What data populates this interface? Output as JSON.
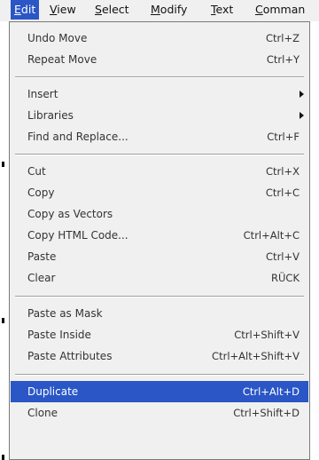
{
  "menubar": {
    "items": [
      {
        "label": "Edit",
        "u": "E",
        "rest": "dit"
      },
      {
        "label": "View",
        "u": "V",
        "rest": "iew"
      },
      {
        "label": "Select",
        "u": "S",
        "rest": "elect"
      },
      {
        "label": "Modify",
        "u": "M",
        "rest": "odify"
      },
      {
        "label": "Text",
        "u": "T",
        "rest": "ext"
      },
      {
        "label": "Comman",
        "u": "C",
        "rest": "omman"
      }
    ]
  },
  "dropdown": {
    "items": [
      {
        "label": "Undo Move",
        "shortcut": "Ctrl+Z"
      },
      {
        "label": "Repeat Move",
        "shortcut": "Ctrl+Y"
      },
      {
        "label": "Insert",
        "shortcut": ""
      },
      {
        "label": "Libraries",
        "shortcut": ""
      },
      {
        "label": "Find and Replace...",
        "shortcut": "Ctrl+F"
      },
      {
        "label": "Cut",
        "shortcut": "Ctrl+X"
      },
      {
        "label": "Copy",
        "shortcut": "Ctrl+C"
      },
      {
        "label": "Copy as Vectors",
        "shortcut": ""
      },
      {
        "label": "Copy HTML Code...",
        "shortcut": "Ctrl+Alt+C"
      },
      {
        "label": "Paste",
        "shortcut": "Ctrl+V"
      },
      {
        "label": "Clear",
        "shortcut": "RÜCK"
      },
      {
        "label": "Paste as Mask",
        "shortcut": ""
      },
      {
        "label": "Paste Inside",
        "shortcut": "Ctrl+Shift+V"
      },
      {
        "label": "Paste Attributes",
        "shortcut": "Ctrl+Alt+Shift+V"
      },
      {
        "label": "Duplicate",
        "shortcut": "Ctrl+Alt+D"
      },
      {
        "label": "Clone",
        "shortcut": "Ctrl+Shift+D"
      }
    ]
  }
}
